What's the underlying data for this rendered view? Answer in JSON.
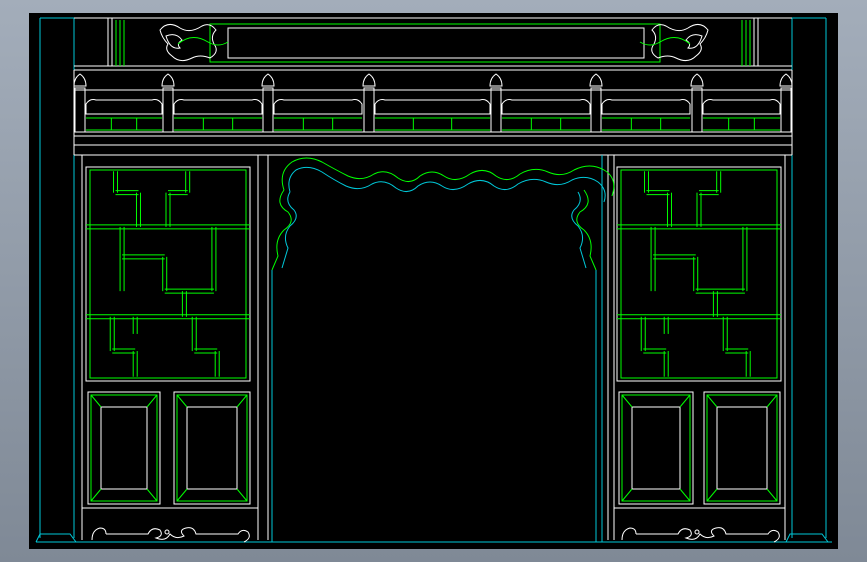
{
  "drawing": {
    "subject": "",
    "colors": {
      "frame": "#00c8d8",
      "outline": "#ffffff",
      "panel": "#00ff00",
      "background": "#000000",
      "window_bg": "#8e98a6"
    },
    "baluster_count": 8,
    "rail_panel_count": 7,
    "lattice_side_count": 2,
    "lower_panel_count": 4
  }
}
